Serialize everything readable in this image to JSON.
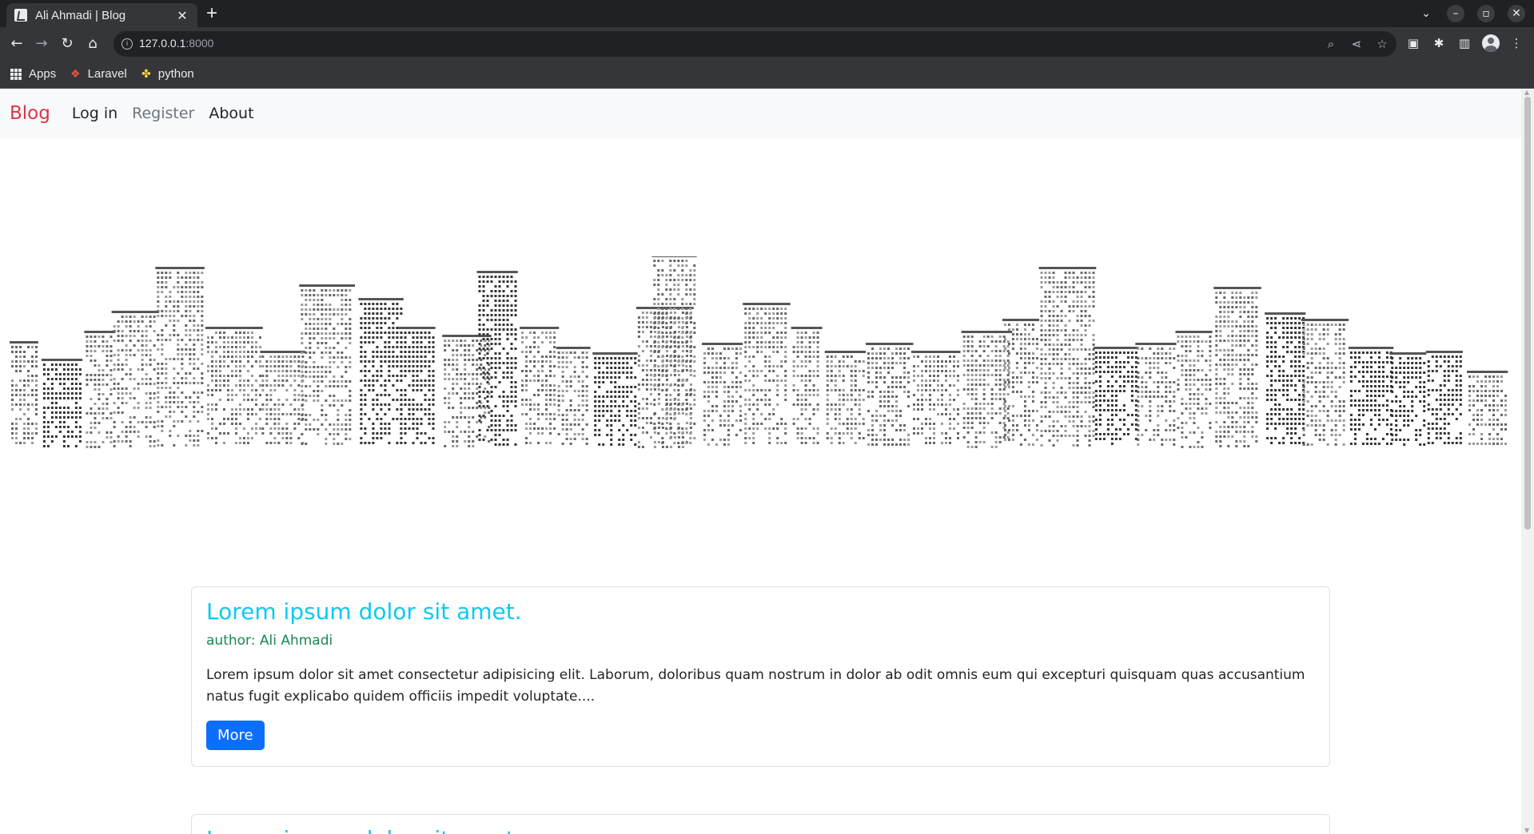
{
  "browser": {
    "tab_title": "Ali Ahmadi | Blog",
    "tab_close": "✕",
    "new_tab": "+",
    "url_host": "127.0.0.1",
    "url_port": ":8000",
    "bookmarks": [
      {
        "label": "Apps",
        "icon": "apps-grid-icon"
      },
      {
        "label": "Laravel",
        "icon": "laravel-icon"
      },
      {
        "label": "python",
        "icon": "python-icon"
      }
    ]
  },
  "site": {
    "brand": "Blog",
    "nav": [
      "Log in",
      "Register",
      "About"
    ],
    "hero_image": "city-skyline-illustration"
  },
  "posts": [
    {
      "title": "Lorem ipsum dolor sit amet.",
      "author": "author: Ali Ahmadi",
      "excerpt": "Lorem ipsum dolor sit amet consectetur adipisicing elit. Laborum, doloribus quam nostrum in dolor ab odit omnis eum qui excepturi quisquam quas accusantium natus fugit explicabo quidem officiis impedit voluptate....",
      "button": "More"
    },
    {
      "title": "Lorem ipsum dolor sit amet."
    }
  ],
  "colors": {
    "brand": "#dc3545",
    "title": "#0dcaf0",
    "author": "#198754",
    "button": "#0d6efd"
  }
}
